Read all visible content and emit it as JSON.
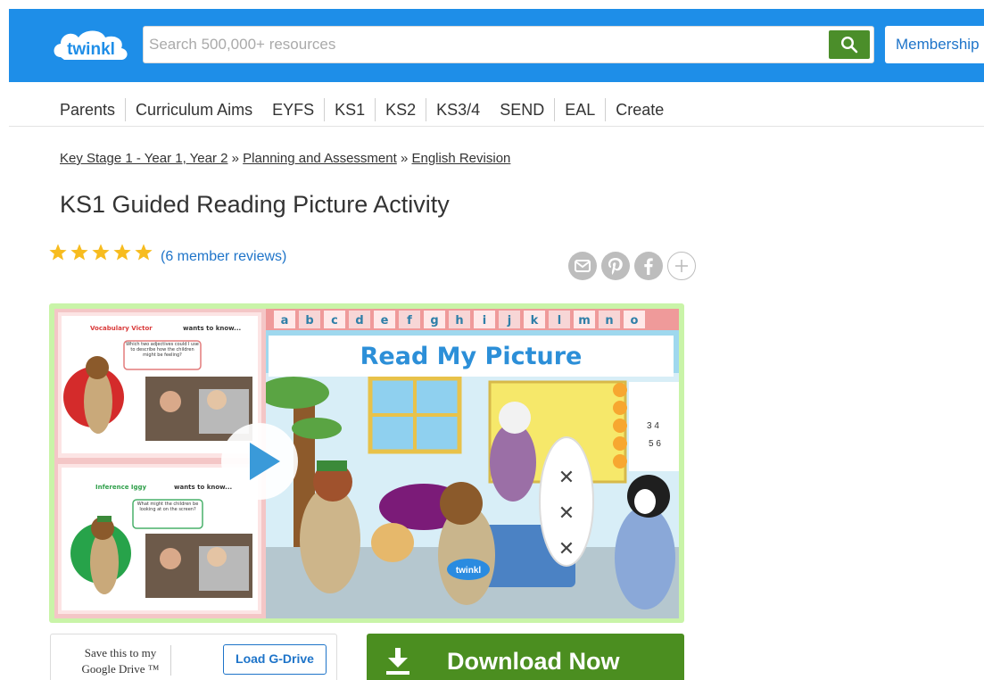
{
  "header": {
    "logo_text": "twinkl",
    "search_placeholder": "Search 500,000+ resources",
    "search_icon": "search-icon",
    "membership_label": "Membership"
  },
  "nav": {
    "items": [
      {
        "label": "Parents"
      },
      {
        "label": "Curriculum Aims"
      },
      {
        "label": "EYFS"
      },
      {
        "label": "KS1"
      },
      {
        "label": "KS2"
      },
      {
        "label": "KS3/4"
      },
      {
        "label": "SEND"
      },
      {
        "label": "EAL"
      },
      {
        "label": "Create"
      }
    ]
  },
  "breadcrumb": {
    "items": [
      {
        "label": "Key Stage 1 - Year 1, Year 2"
      },
      {
        "label": "Planning and Assessment"
      },
      {
        "label": "English Revision"
      }
    ],
    "separator": "»"
  },
  "page": {
    "title": "KS1 Guided Reading Picture Activity"
  },
  "rating": {
    "stars": 5,
    "max_stars": 5,
    "reviews_label": "(6 member reviews)"
  },
  "share": {
    "icons": [
      "email-icon",
      "pinterest-icon",
      "facebook-icon",
      "plus-icon"
    ]
  },
  "preview": {
    "main_title": "Read My Picture",
    "alphabet_banner": "abcdefghijklmno",
    "card1_heading_name": "Vocabulary Victor",
    "card1_heading_rest": "wants to know...",
    "card1_bubble": "Which two adjectives could I use to describe how the children might be feeling?",
    "card2_heading_name": "Inference Iggy",
    "card2_heading_rest": "wants to know...",
    "card2_bubble": "What might the children be looking at on the screen?",
    "watermark": "twinkl",
    "play_icon": "play-icon"
  },
  "actions": {
    "gdrive_text_line1": "Save this to my",
    "gdrive_text_line2": "Google Drive ™",
    "gdrive_button_label": "Load G-Drive",
    "download_label": "Download Now",
    "download_icon": "download-icon"
  },
  "colors": {
    "header_blue": "#1e8ee8",
    "link_blue": "#1e74c9",
    "download_green": "#4b8e20",
    "star_gold": "#f7bc1f",
    "preview_border": "#c9f4a8"
  }
}
